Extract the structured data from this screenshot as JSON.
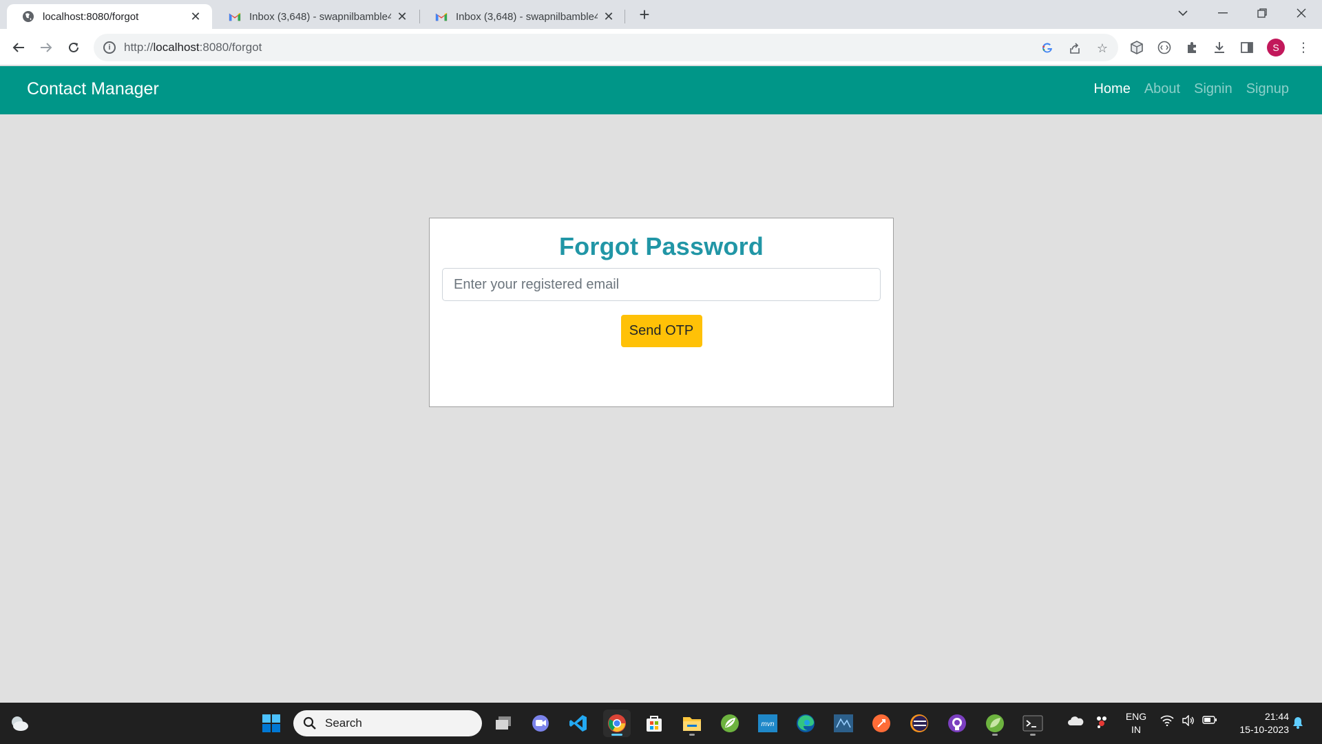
{
  "browser": {
    "tabs": [
      {
        "title": "localhost:8080/forgot",
        "active": true
      },
      {
        "title": "Inbox (3,648) - swapnilbamble4",
        "active": false
      },
      {
        "title": "Inbox (3,648) - swapnilbamble4",
        "active": false
      }
    ],
    "new_tab": "+",
    "url_host": "localhost",
    "url_prefix": "http://",
    "url_rest": ":8080/forgot",
    "profile_initial": "S"
  },
  "navbar": {
    "brand": "Contact Manager",
    "links": [
      {
        "label": "Home",
        "active": true
      },
      {
        "label": "About",
        "active": false
      },
      {
        "label": "Signin",
        "active": false
      },
      {
        "label": "Signup",
        "active": false
      }
    ],
    "color": "#009688"
  },
  "forgot": {
    "title": "Forgot Password",
    "email_placeholder": "Enter your registered email",
    "email_value": "",
    "button_label": "Send OTP",
    "title_color": "#2196a6",
    "button_color": "#ffc107"
  },
  "taskbar": {
    "search_placeholder": "Search",
    "language": "ENG",
    "region": "IN",
    "time": "21:44",
    "date": "15-10-2023",
    "apps": [
      "start",
      "search",
      "task-view",
      "teams",
      "vscode",
      "chrome",
      "store",
      "file-explorer",
      "spring-tools",
      "mvnrepository",
      "edge",
      "mysql-workbench",
      "postman",
      "eclipse",
      "github-desktop",
      "spring-boot",
      "terminal"
    ]
  }
}
